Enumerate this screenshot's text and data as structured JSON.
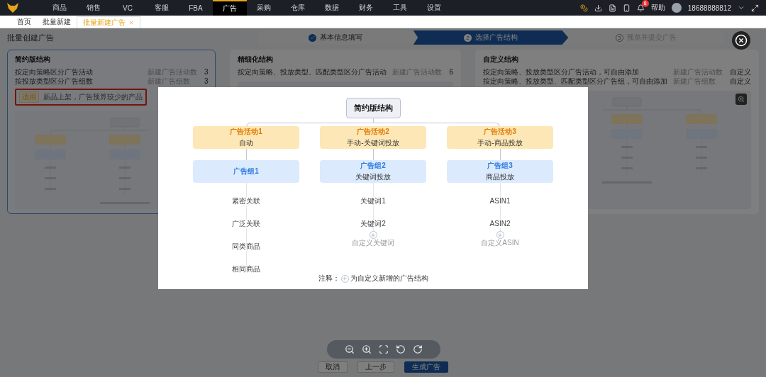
{
  "nav": {
    "items": [
      {
        "label": "商品",
        "selected": false
      },
      {
        "label": "销售",
        "selected": false
      },
      {
        "label": "VC",
        "selected": false
      },
      {
        "label": "客服",
        "selected": false
      },
      {
        "label": "FBA",
        "selected": false
      },
      {
        "label": "广告",
        "selected": true
      },
      {
        "label": "采购",
        "selected": false
      },
      {
        "label": "仓库",
        "selected": false
      },
      {
        "label": "数据",
        "selected": false
      },
      {
        "label": "财务",
        "selected": false
      },
      {
        "label": "工具",
        "selected": false
      },
      {
        "label": "设置",
        "selected": false
      }
    ],
    "notification_count": "8",
    "help": "帮助",
    "user": "18688888812"
  },
  "tabs": [
    {
      "label": "首页",
      "selected": false,
      "closable": false
    },
    {
      "label": "批量新建",
      "selected": false,
      "closable": false
    },
    {
      "label": "批量新建广告",
      "selected": true,
      "closable": true
    }
  ],
  "page": {
    "title": "批量创建广告",
    "steps": [
      {
        "label": "基本信息填写",
        "done": true,
        "selected": false
      },
      {
        "number": "2",
        "label": "选择广告结构",
        "done": false,
        "selected": true
      },
      {
        "number": "3",
        "label": "预览并提交广告",
        "done": false,
        "selected": false
      }
    ],
    "cards": [
      {
        "title": "简约版结构",
        "selected": true,
        "lines": [
          {
            "text": "按定向策略区分广告活动",
            "label": "新建广告活动数",
            "value": "3"
          },
          {
            "text": "按投放类型区分广告组数",
            "label": "新建广告组数",
            "value": "3"
          }
        ],
        "tag": {
          "label": "适用",
          "text": "新品上架，广告预算较少的产品",
          "highlighted": true
        }
      },
      {
        "title": "精细化结构",
        "selected": false,
        "lines": [
          {
            "text": "按定向策略、投放类型、匹配类型区分广告活动",
            "label": "新建广告活动数",
            "value": "6"
          }
        ]
      },
      {
        "title": "自定义结构",
        "selected": false,
        "preview_button": true,
        "lines": [
          {
            "text": "按定向策略、投放类型区分广告活动，可自由添加",
            "label": "新建广告活动数",
            "value": "自定义"
          },
          {
            "text": "按定向策略、投放类型、匹配类型区分广告组，可自由添加",
            "label": "新建广告组数",
            "value": "自定义"
          }
        ]
      }
    ],
    "buttons": [
      {
        "label": "取消",
        "kind": "default"
      },
      {
        "label": "上一步",
        "kind": "default"
      },
      {
        "label": "生成广告",
        "kind": "primary"
      }
    ]
  },
  "viewer": {
    "root": "简约版结构",
    "columns": [
      {
        "campaign": {
          "title": "广告活动1",
          "subtitle": "自动"
        },
        "group": {
          "title": "广告组1"
        },
        "items": [
          "紧密关联",
          "广泛关联",
          "同类商品",
          "相同商品"
        ]
      },
      {
        "campaign": {
          "title": "广告活动2",
          "subtitle": "手动-关键词投放"
        },
        "group": {
          "title": "广告组2",
          "subtitle": "关键词投放"
        },
        "items": [
          "关键词1",
          "关键词2"
        ],
        "custom": "自定义关键词"
      },
      {
        "campaign": {
          "title": "广告活动3",
          "subtitle": "手动-商品投放"
        },
        "group": {
          "title": "广告组3",
          "subtitle": "商品投放"
        },
        "items": [
          "ASIN1",
          "ASIN2"
        ],
        "custom": "自定义ASIN"
      }
    ],
    "note_label": "注释：",
    "note_text": "为自定义新增的广告结构"
  }
}
